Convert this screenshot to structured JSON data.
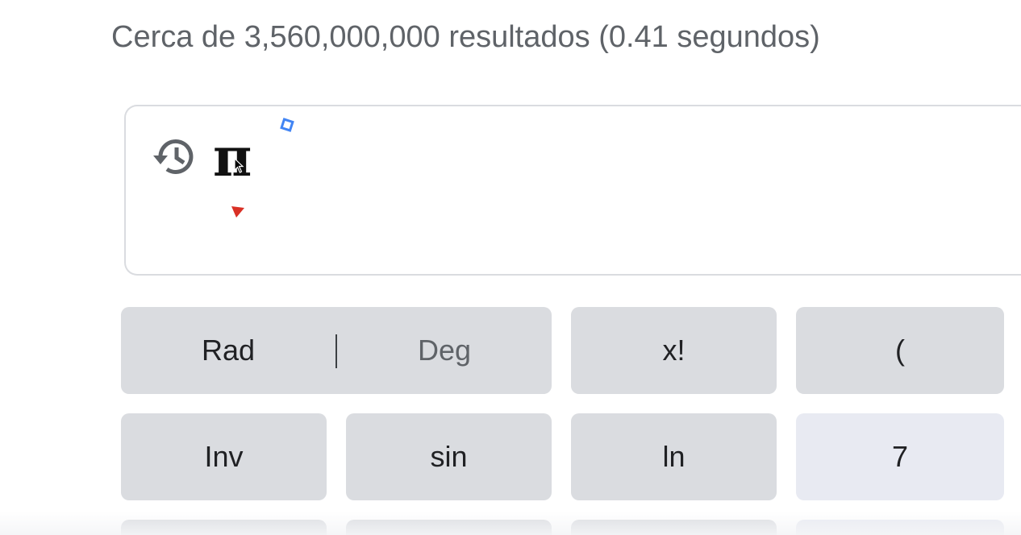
{
  "search": {
    "result_stats": "Cerca de 3,560,000,000 resultados (0.41 segundos)"
  },
  "calculator": {
    "display_value": "π",
    "icons": {
      "history": "history-icon",
      "cursor": "mouse-cursor-icon",
      "diamond_marker": "diamond-marker-icon",
      "triangle_marker": "triangle-marker-icon"
    },
    "colors": {
      "key_function": "#dadce0",
      "key_number": "#e8eaf2",
      "text": "#202124",
      "text_inactive": "#5f6368",
      "marker_blue": "#4285f4",
      "marker_red": "#d93025"
    },
    "keys": {
      "rad": "Rad",
      "deg": "Deg",
      "factorial": "x!",
      "open_paren": "(",
      "inv": "Inv",
      "sin": "sin",
      "ln": "ln",
      "seven": "7"
    }
  }
}
